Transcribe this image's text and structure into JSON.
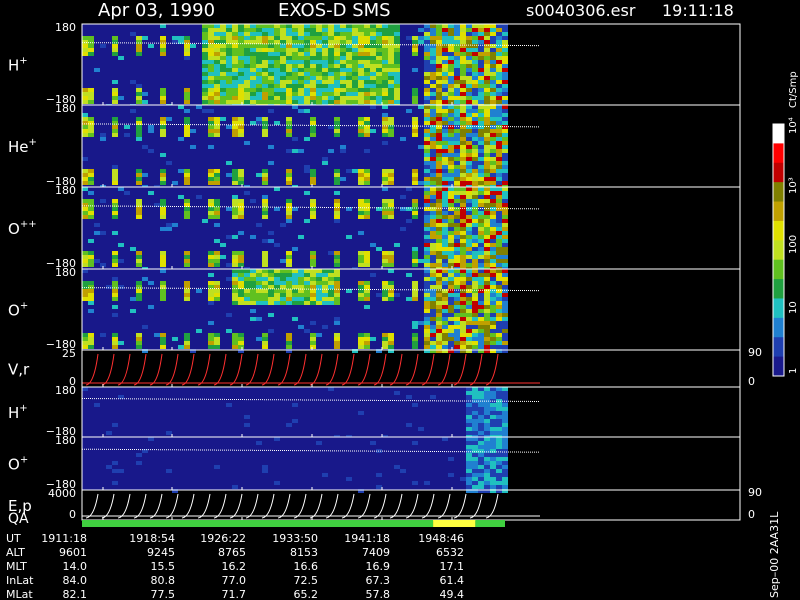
{
  "header": {
    "date": "Apr 03, 1990",
    "instrument": "EXOS-D SMS",
    "file": "s0040306.esr",
    "time": "19:11:18"
  },
  "colorbar": {
    "unit": "Ct/Smp",
    "ticks": [
      {
        "value": "10⁴",
        "level": 4
      },
      {
        "value": "10³",
        "level": 3
      },
      {
        "value": "100",
        "level": 2
      },
      {
        "value": "10",
        "level": 1
      },
      {
        "value": "1",
        "level": 0
      }
    ],
    "colors": [
      "#1a1a8c",
      "#1f3fb0",
      "#2080d0",
      "#20c0c0",
      "#20a040",
      "#60c020",
      "#c0e020",
      "#e0e000",
      "#c0a000",
      "#808000",
      "#c00000",
      "#ff0000",
      "#ffffff"
    ]
  },
  "footer": {
    "side_label": "Sep–00 2AA31L",
    "rows": [
      {
        "label": "UT",
        "values": [
          "1911:18",
          "1918:54",
          "1926:22",
          "1933:50",
          "1941:18",
          "1948:46"
        ]
      },
      {
        "label": "ALT",
        "values": [
          "9601",
          "9245",
          "8765",
          "8153",
          "7409",
          "6532"
        ]
      },
      {
        "label": "MLT",
        "values": [
          "14.0",
          "15.5",
          "16.2",
          "16.6",
          "16.9",
          "17.1"
        ]
      },
      {
        "label": "InLat",
        "values": [
          "84.0",
          "80.8",
          "77.0",
          "72.5",
          "67.3",
          "61.4"
        ]
      },
      {
        "label": "MLat",
        "values": [
          "82.1",
          "77.5",
          "71.7",
          "65.2",
          "57.8",
          "49.4"
        ]
      }
    ]
  },
  "chart_data": {
    "type": "heatmap",
    "x_label": "UT",
    "x_ticks": [
      "1911:18",
      "1918:54",
      "1926:22",
      "1933:50",
      "1941:18",
      "1948:46"
    ],
    "panels": [
      {
        "name": "H+",
        "label": "H",
        "sup": "+",
        "yticks": [
          "180",
          "−180"
        ],
        "type": "spectrogram"
      },
      {
        "name": "He+",
        "label": "He",
        "sup": "+",
        "yticks": [
          "180",
          "−180"
        ],
        "type": "spectrogram"
      },
      {
        "name": "O++",
        "label": "O",
        "sup": "++",
        "yticks": [
          "180",
          "−180"
        ],
        "type": "spectrogram"
      },
      {
        "name": "O+",
        "label": "O",
        "sup": "+",
        "yticks": [
          "180",
          "−180"
        ],
        "type": "spectrogram"
      },
      {
        "name": "V,r",
        "label": "V,r",
        "sup": "",
        "yticks": [
          "25",
          "0"
        ],
        "right_ticks": [
          "90",
          "0"
        ],
        "type": "line"
      },
      {
        "name": "H+ (2)",
        "label": "H",
        "sup": "+",
        "yticks": [
          "180",
          "−180"
        ],
        "type": "spectrogram"
      },
      {
        "name": "O+ (2)",
        "label": "O",
        "sup": "+",
        "yticks": [
          "180",
          "−180"
        ],
        "type": "spectrogram"
      },
      {
        "name": "E,p",
        "label": "E,p",
        "sup": "",
        "yticks": [
          "4000",
          "0"
        ],
        "right_ticks": [
          "90",
          "0"
        ],
        "type": "line"
      }
    ],
    "qa_label": "QA",
    "qa_segments": [
      {
        "start": 0.0,
        "end": 0.83,
        "color": "#40d040"
      },
      {
        "start": 0.83,
        "end": 0.93,
        "color": "#ffff40"
      },
      {
        "start": 0.93,
        "end": 1.0,
        "color": "#40d040"
      }
    ],
    "log_scale": true
  }
}
